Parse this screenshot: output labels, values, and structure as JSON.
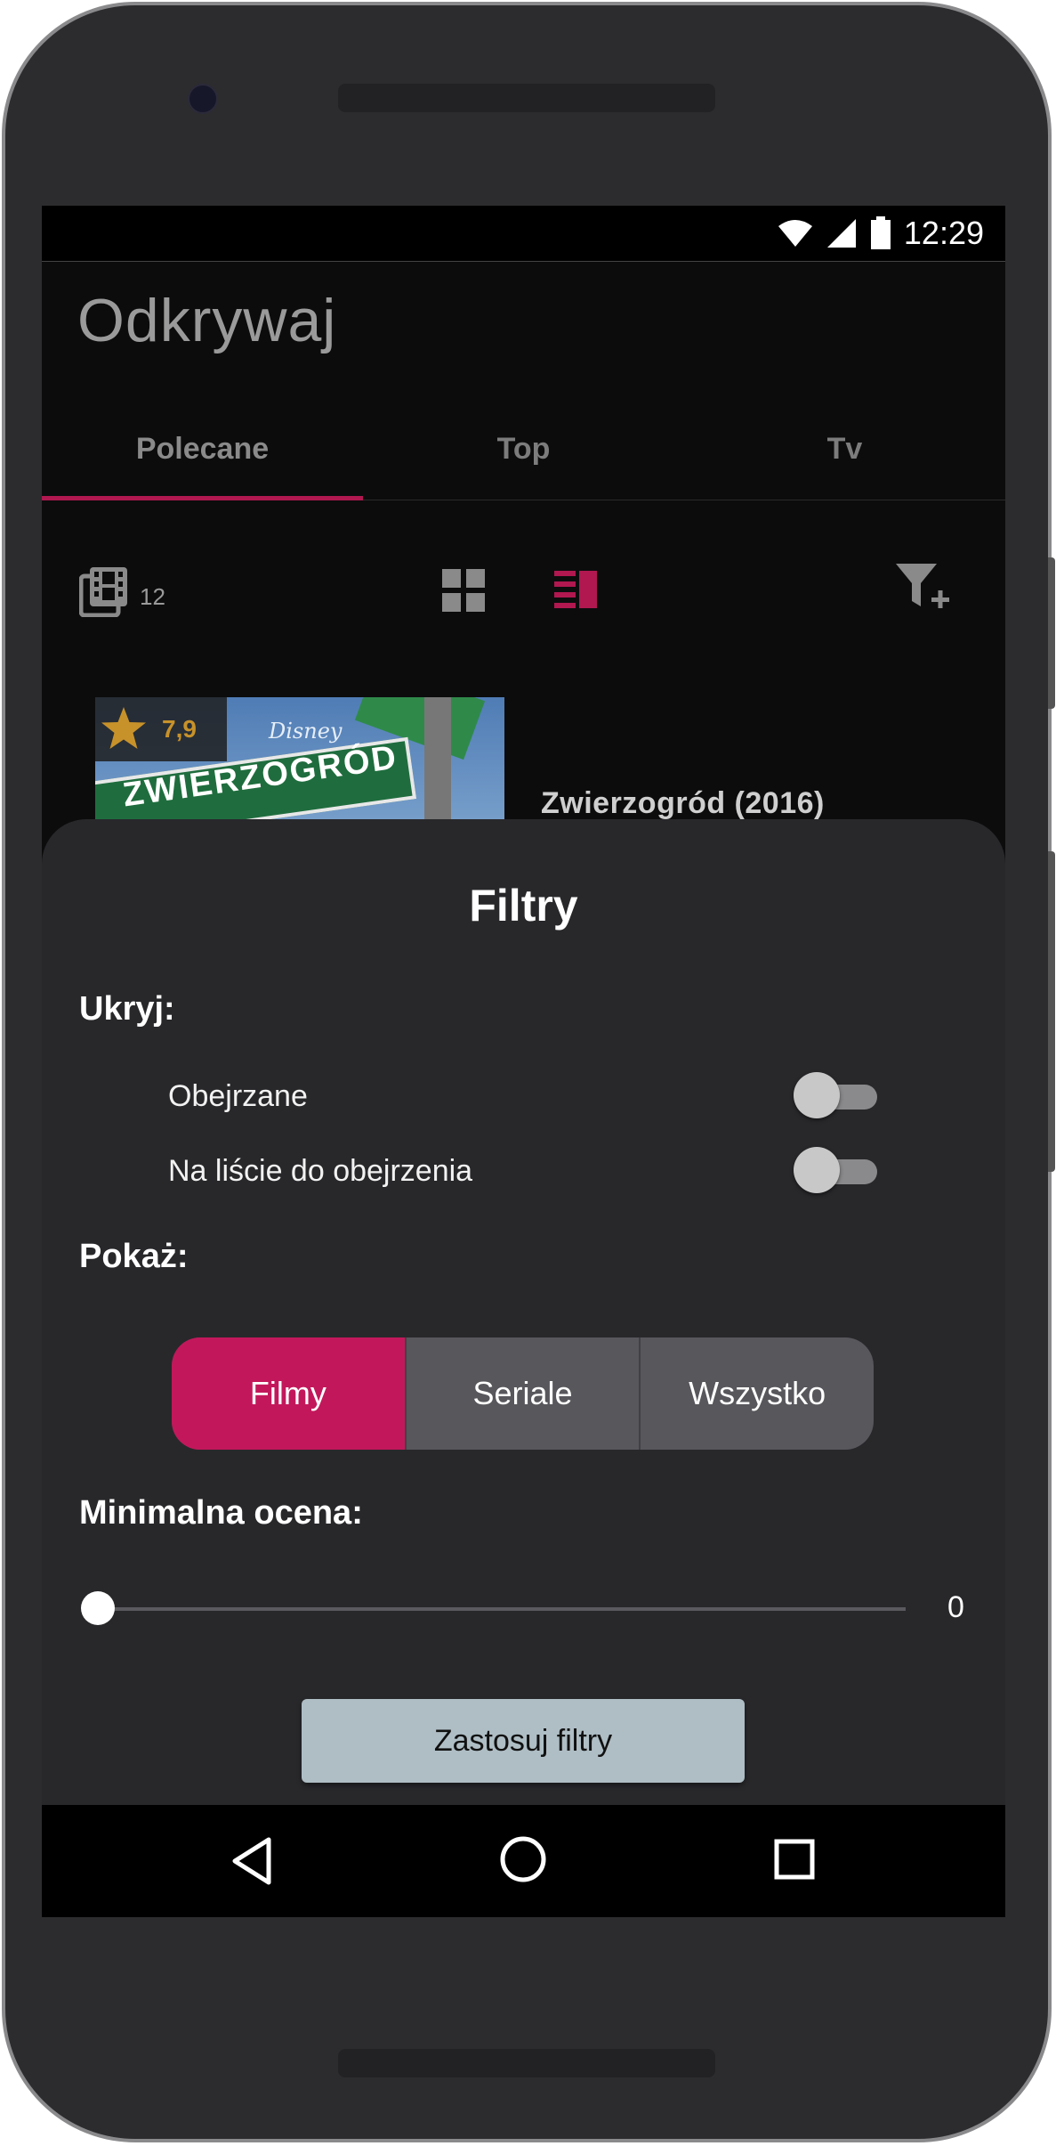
{
  "status_bar": {
    "time": "12:29",
    "icons": [
      "wifi-icon",
      "signal-icon",
      "battery-icon"
    ]
  },
  "app": {
    "title": "Odkrywaj"
  },
  "tabs": [
    {
      "label": "Polecane",
      "active": true
    },
    {
      "label": "Top",
      "active": false
    },
    {
      "label": "Tv",
      "active": false
    }
  ],
  "toolbar": {
    "count": "12",
    "icons": [
      "film-library-icon",
      "grid-view-icon",
      "list-view-icon",
      "filter-add-icon"
    ]
  },
  "movie": {
    "rating": "7,9",
    "title": "Zwierzogród (2016)",
    "poster_text": "ZWIERZOGRÓD",
    "poster_brand": "Disney"
  },
  "filters": {
    "title": "Filtry",
    "hide_label": "Ukryj:",
    "hide_options": [
      {
        "label": "Obejrzane",
        "on": false
      },
      {
        "label": "Na liście do obejrzenia",
        "on": false
      }
    ],
    "show_label": "Pokaż:",
    "show_options": [
      {
        "label": "Filmy",
        "active": true
      },
      {
        "label": "Seriale",
        "active": false
      },
      {
        "label": "Wszystko",
        "active": false
      }
    ],
    "min_rating_label": "Minimalna ocena:",
    "min_rating_value": "0",
    "apply_label": "Zastosuj filtry"
  },
  "colors": {
    "accent": "#c2185b",
    "sheet_bg": "#28282b",
    "rating": "#c8922a",
    "apply_btn": "#afbec5"
  },
  "navbar": {
    "icons": [
      "back-icon",
      "home-icon",
      "recents-icon"
    ]
  }
}
